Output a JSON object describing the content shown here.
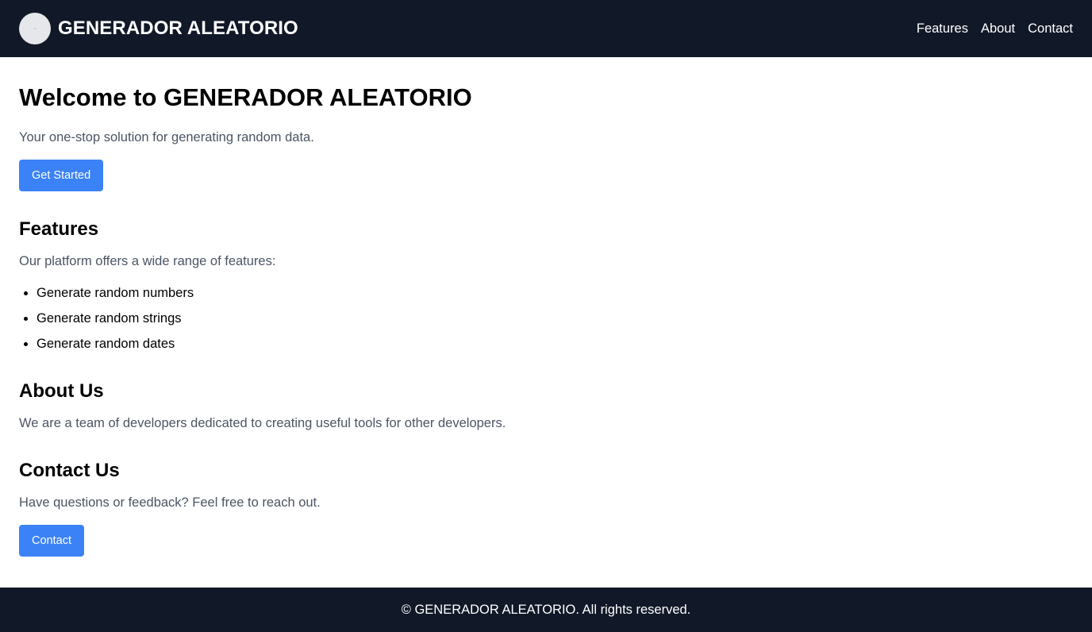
{
  "header": {
    "brand": "GENERADOR ALEATORIO",
    "nav": [
      "Features",
      "About",
      "Contact"
    ]
  },
  "hero": {
    "title": "Welcome to GENERADOR ALEATORIO",
    "subtitle": "Your one-stop solution for generating random data.",
    "cta_label": "Get Started"
  },
  "features": {
    "title": "Features",
    "intro": "Our platform offers a wide range of features:",
    "items": [
      "Generate random numbers",
      "Generate random strings",
      "Generate random dates"
    ]
  },
  "about": {
    "title": "About Us",
    "text": "We are a team of developers dedicated to creating useful tools for other developers."
  },
  "contact": {
    "title": "Contact Us",
    "text": "Have questions or feedback? Feel free to reach out.",
    "button_label": "Contact"
  },
  "footer": {
    "text": "© GENERADOR ALEATORIO. All rights reserved."
  },
  "colors": {
    "nav_background": "#111827",
    "accent": "#3b82f6",
    "muted_text": "#4b5563"
  },
  "icons": {
    "logo": "logo-circle-icon"
  }
}
